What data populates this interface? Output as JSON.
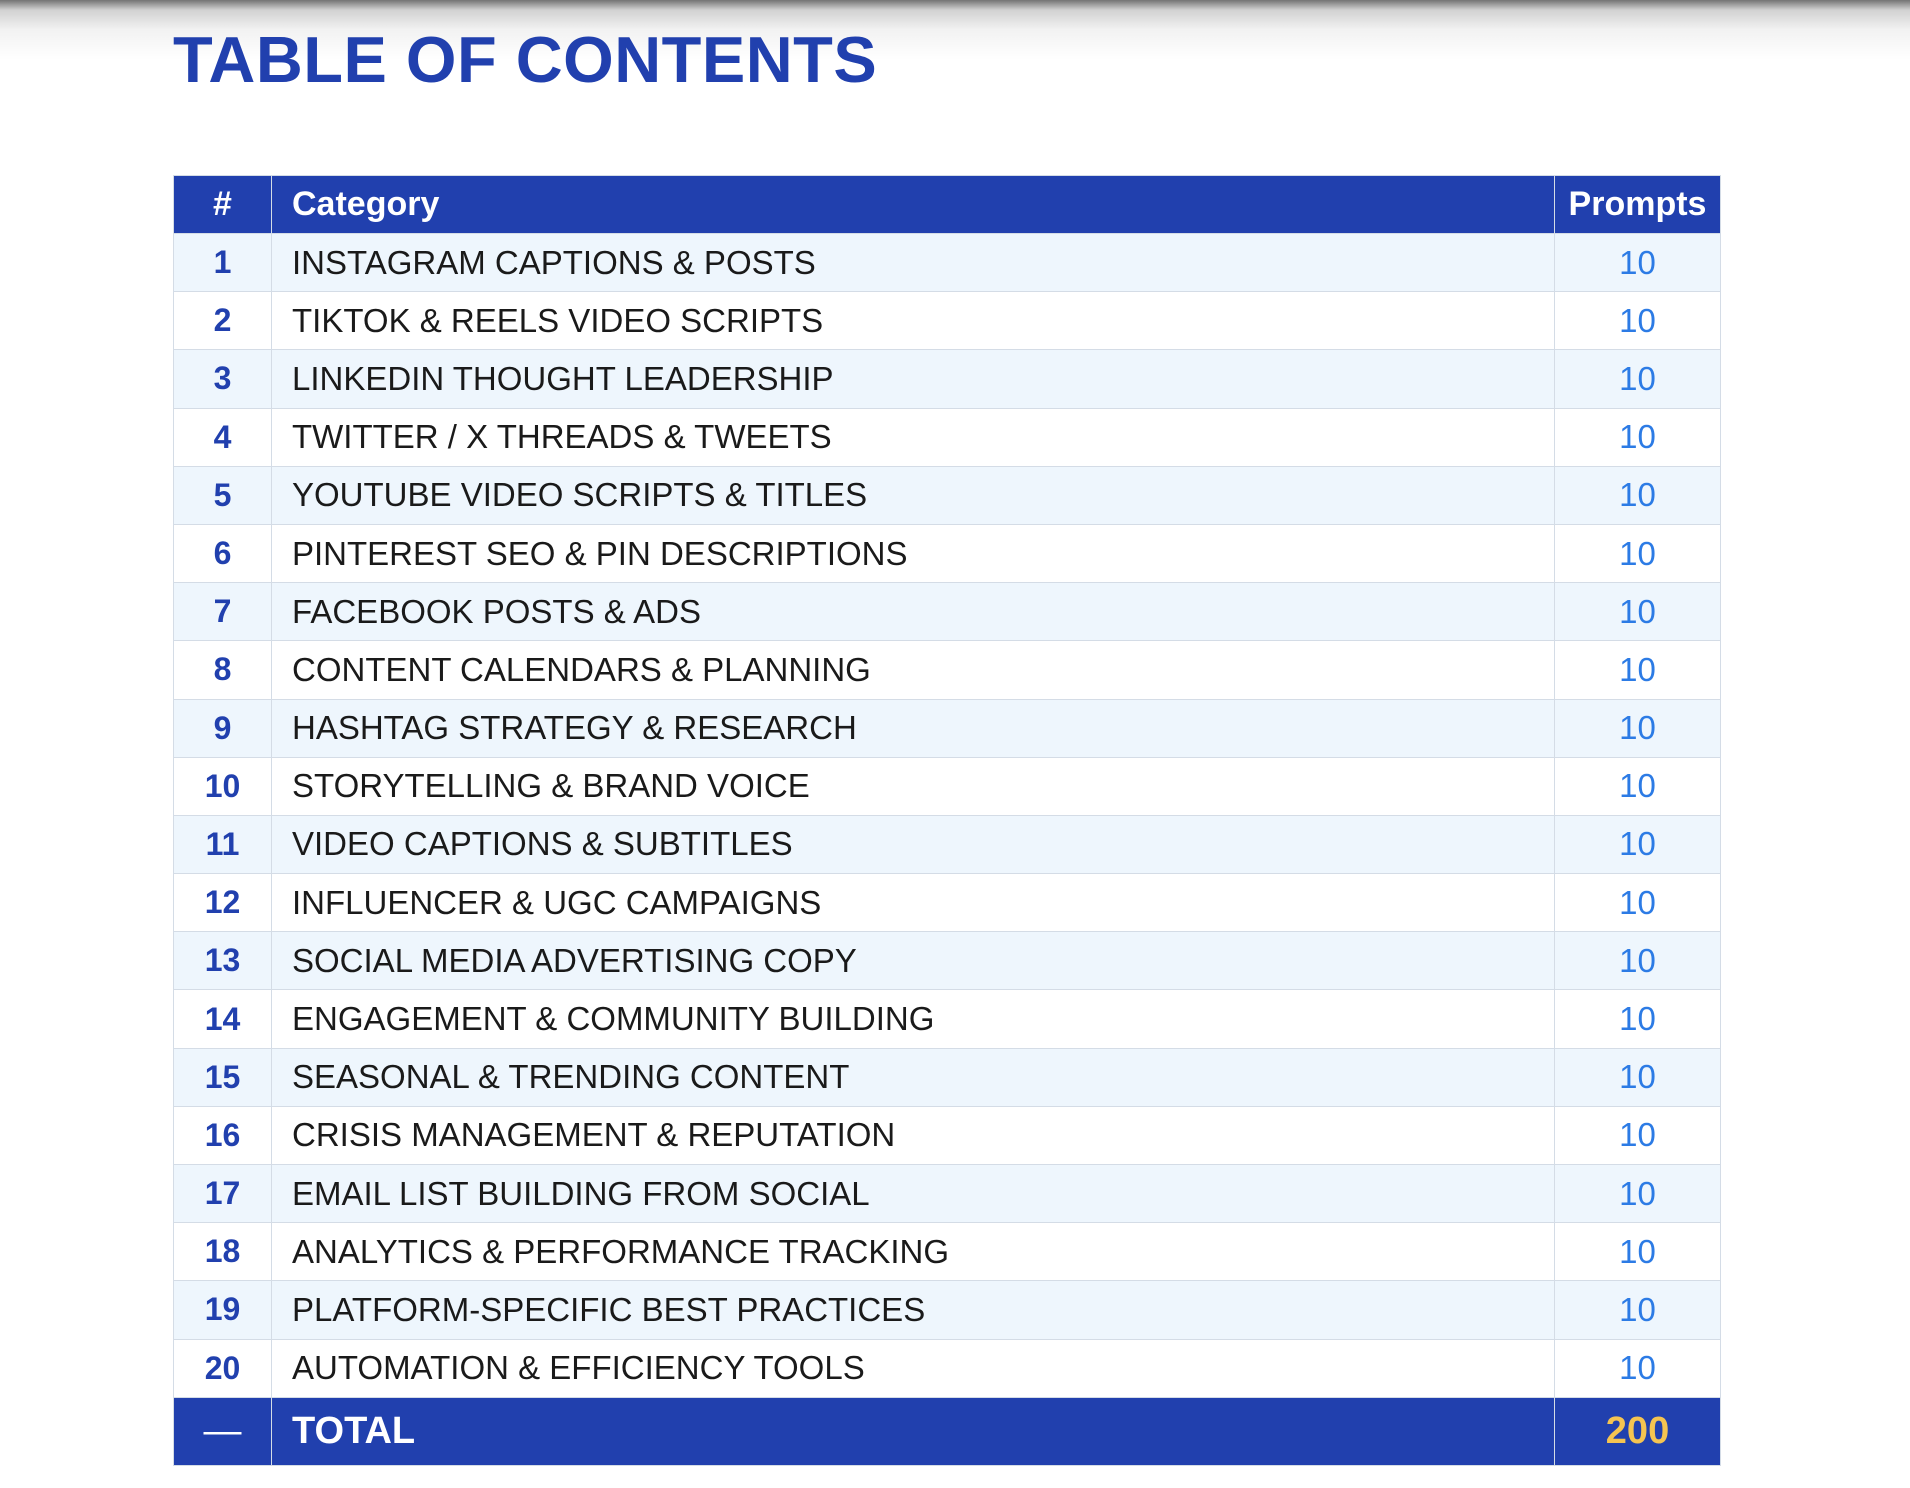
{
  "colors": {
    "title": "#2140ae",
    "header_bg": "#2140ae",
    "row_alt_bg": "#eef6fd",
    "row_bg": "#ffffff",
    "number_text": "#2140ae",
    "prompts_text": "#2c7be5",
    "total_value": "#f5c451",
    "border": "#d4dce6"
  },
  "title": "TABLE OF CONTENTS",
  "table": {
    "headers": {
      "number": "#",
      "category": "Category",
      "prompts": "Prompts"
    },
    "rows": [
      {
        "number": "1",
        "category": "INSTAGRAM CAPTIONS & POSTS",
        "prompts": "10"
      },
      {
        "number": "2",
        "category": "TIKTOK & REELS VIDEO SCRIPTS",
        "prompts": "10"
      },
      {
        "number": "3",
        "category": "LINKEDIN THOUGHT LEADERSHIP",
        "prompts": "10"
      },
      {
        "number": "4",
        "category": "TWITTER / X THREADS & TWEETS",
        "prompts": "10"
      },
      {
        "number": "5",
        "category": "YOUTUBE VIDEO SCRIPTS & TITLES",
        "prompts": "10"
      },
      {
        "number": "6",
        "category": "PINTEREST SEO & PIN DESCRIPTIONS",
        "prompts": "10"
      },
      {
        "number": "7",
        "category": "FACEBOOK POSTS & ADS",
        "prompts": "10"
      },
      {
        "number": "8",
        "category": "CONTENT CALENDARS & PLANNING",
        "prompts": "10"
      },
      {
        "number": "9",
        "category": "HASHTAG STRATEGY & RESEARCH",
        "prompts": "10"
      },
      {
        "number": "10",
        "category": "STORYTELLING & BRAND VOICE",
        "prompts": "10"
      },
      {
        "number": "11",
        "category": "VIDEO CAPTIONS & SUBTITLES",
        "prompts": "10"
      },
      {
        "number": "12",
        "category": "INFLUENCER & UGC CAMPAIGNS",
        "prompts": "10"
      },
      {
        "number": "13",
        "category": "SOCIAL MEDIA ADVERTISING COPY",
        "prompts": "10"
      },
      {
        "number": "14",
        "category": "ENGAGEMENT & COMMUNITY BUILDING",
        "prompts": "10"
      },
      {
        "number": "15",
        "category": "SEASONAL & TRENDING CONTENT",
        "prompts": "10"
      },
      {
        "number": "16",
        "category": "CRISIS MANAGEMENT & REPUTATION",
        "prompts": "10"
      },
      {
        "number": "17",
        "category": "EMAIL LIST BUILDING FROM SOCIAL",
        "prompts": "10"
      },
      {
        "number": "18",
        "category": "ANALYTICS & PERFORMANCE TRACKING",
        "prompts": "10"
      },
      {
        "number": "19",
        "category": "PLATFORM-SPECIFIC BEST PRACTICES",
        "prompts": "10"
      },
      {
        "number": "20",
        "category": "AUTOMATION & EFFICIENCY TOOLS",
        "prompts": "10"
      }
    ],
    "total": {
      "number": "—",
      "label": "TOTAL",
      "value": "200"
    }
  }
}
